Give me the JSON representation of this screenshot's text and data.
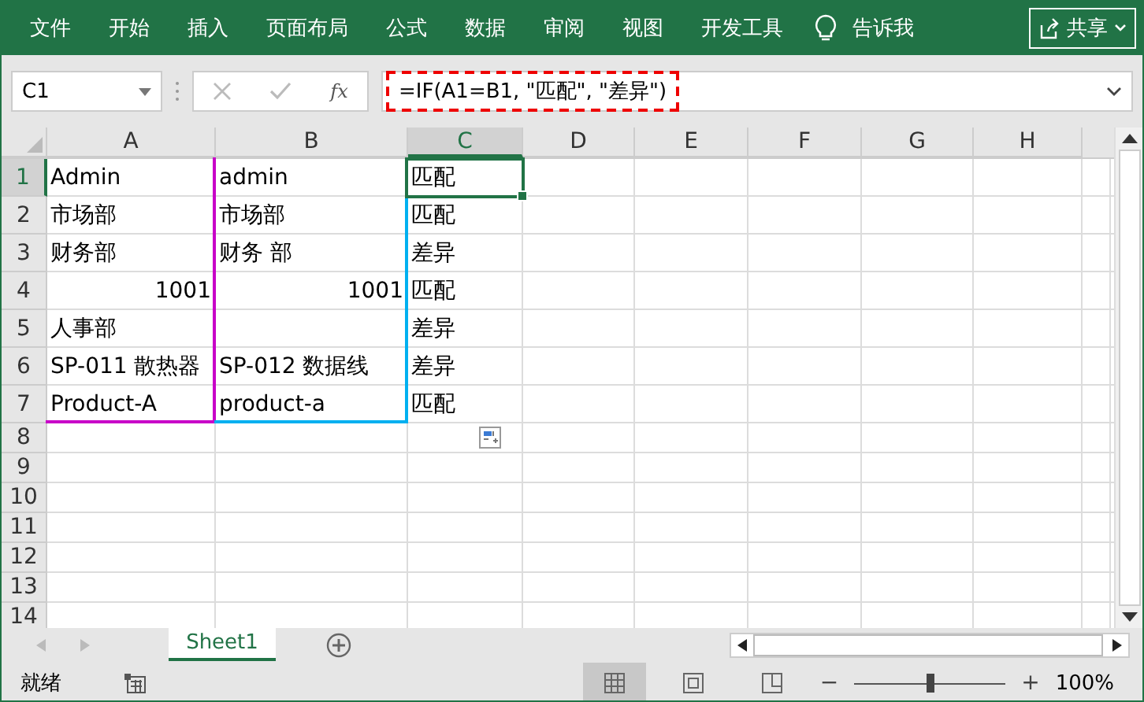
{
  "ribbon": {
    "tabs": [
      {
        "label": "文件"
      },
      {
        "label": "开始"
      },
      {
        "label": "插入"
      },
      {
        "label": "页面布局"
      },
      {
        "label": "公式"
      },
      {
        "label": "数据"
      },
      {
        "label": "审阅"
      },
      {
        "label": "视图"
      },
      {
        "label": "开发工具"
      }
    ],
    "tell_me": "告诉我",
    "share": "共享"
  },
  "formula_bar": {
    "name_box": "C1",
    "fx": "fx",
    "formula": "=IF(A1=B1, \"匹配\", \"差异\")"
  },
  "columns": [
    {
      "label": "A",
      "color": "#c800c8"
    },
    {
      "label": "B",
      "color": "#00b0f0"
    },
    {
      "label": "C"
    },
    {
      "label": "D"
    },
    {
      "label": "E"
    },
    {
      "label": "F"
    },
    {
      "label": "G"
    },
    {
      "label": "H"
    }
  ],
  "rows": [
    {
      "label": "1",
      "cells": [
        {
          "text": "Admin",
          "kind": "text",
          "selected": false
        },
        {
          "text": "admin",
          "kind": "text",
          "selected": false
        },
        {
          "text": "匹配",
          "kind": "text",
          "selected": true
        }
      ]
    },
    {
      "label": "2",
      "cells": [
        {
          "text": "市场部",
          "kind": "text",
          "selected": false
        },
        {
          "text": "市场部",
          "kind": "text",
          "selected": false
        },
        {
          "text": "匹配",
          "kind": "text",
          "selected": false
        }
      ]
    },
    {
      "label": "3",
      "cells": [
        {
          "text": "财务部",
          "kind": "text",
          "selected": false
        },
        {
          "text": "财务 部",
          "kind": "text",
          "selected": false
        },
        {
          "text": "差异",
          "kind": "text",
          "selected": false
        }
      ]
    },
    {
      "label": "4",
      "cells": [
        {
          "text": "1001",
          "kind": "number",
          "selected": false
        },
        {
          "text": "1001",
          "kind": "number",
          "selected": false
        },
        {
          "text": "匹配",
          "kind": "text",
          "selected": false
        }
      ]
    },
    {
      "label": "5",
      "cells": [
        {
          "text": "人事部",
          "kind": "text",
          "selected": false
        },
        {
          "kind": "empty",
          "selected": false
        },
        {
          "text": "差异",
          "kind": "text",
          "selected": false
        }
      ]
    },
    {
      "label": "6",
      "cells": [
        {
          "text": "SP-011 散热器",
          "kind": "text",
          "selected": false
        },
        {
          "text": "SP-012 数据线",
          "kind": "text",
          "selected": false
        },
        {
          "text": "差异",
          "kind": "text",
          "selected": false
        }
      ]
    },
    {
      "label": "7",
      "cells": [
        {
          "text": "Product-A",
          "kind": "text",
          "selected": false
        },
        {
          "text": "product-a",
          "kind": "text",
          "selected": false
        },
        {
          "text": "匹配",
          "kind": "text",
          "selected": false
        }
      ]
    },
    {
      "label": "8",
      "cells": []
    },
    {
      "label": "9",
      "cells": []
    },
    {
      "label": "10",
      "cells": []
    },
    {
      "label": "11",
      "cells": []
    },
    {
      "label": "12",
      "cells": []
    },
    {
      "label": "13",
      "cells": []
    },
    {
      "label": "14",
      "cells": []
    }
  ],
  "sheet_tabs": [
    {
      "label": "Sheet1",
      "selected": true
    }
  ],
  "status_bar": {
    "status": "就绪",
    "zoom_out": "−",
    "zoom_slider": {
      "level": 0.5
    },
    "zoom_in": "+",
    "zoom": "100%"
  }
}
